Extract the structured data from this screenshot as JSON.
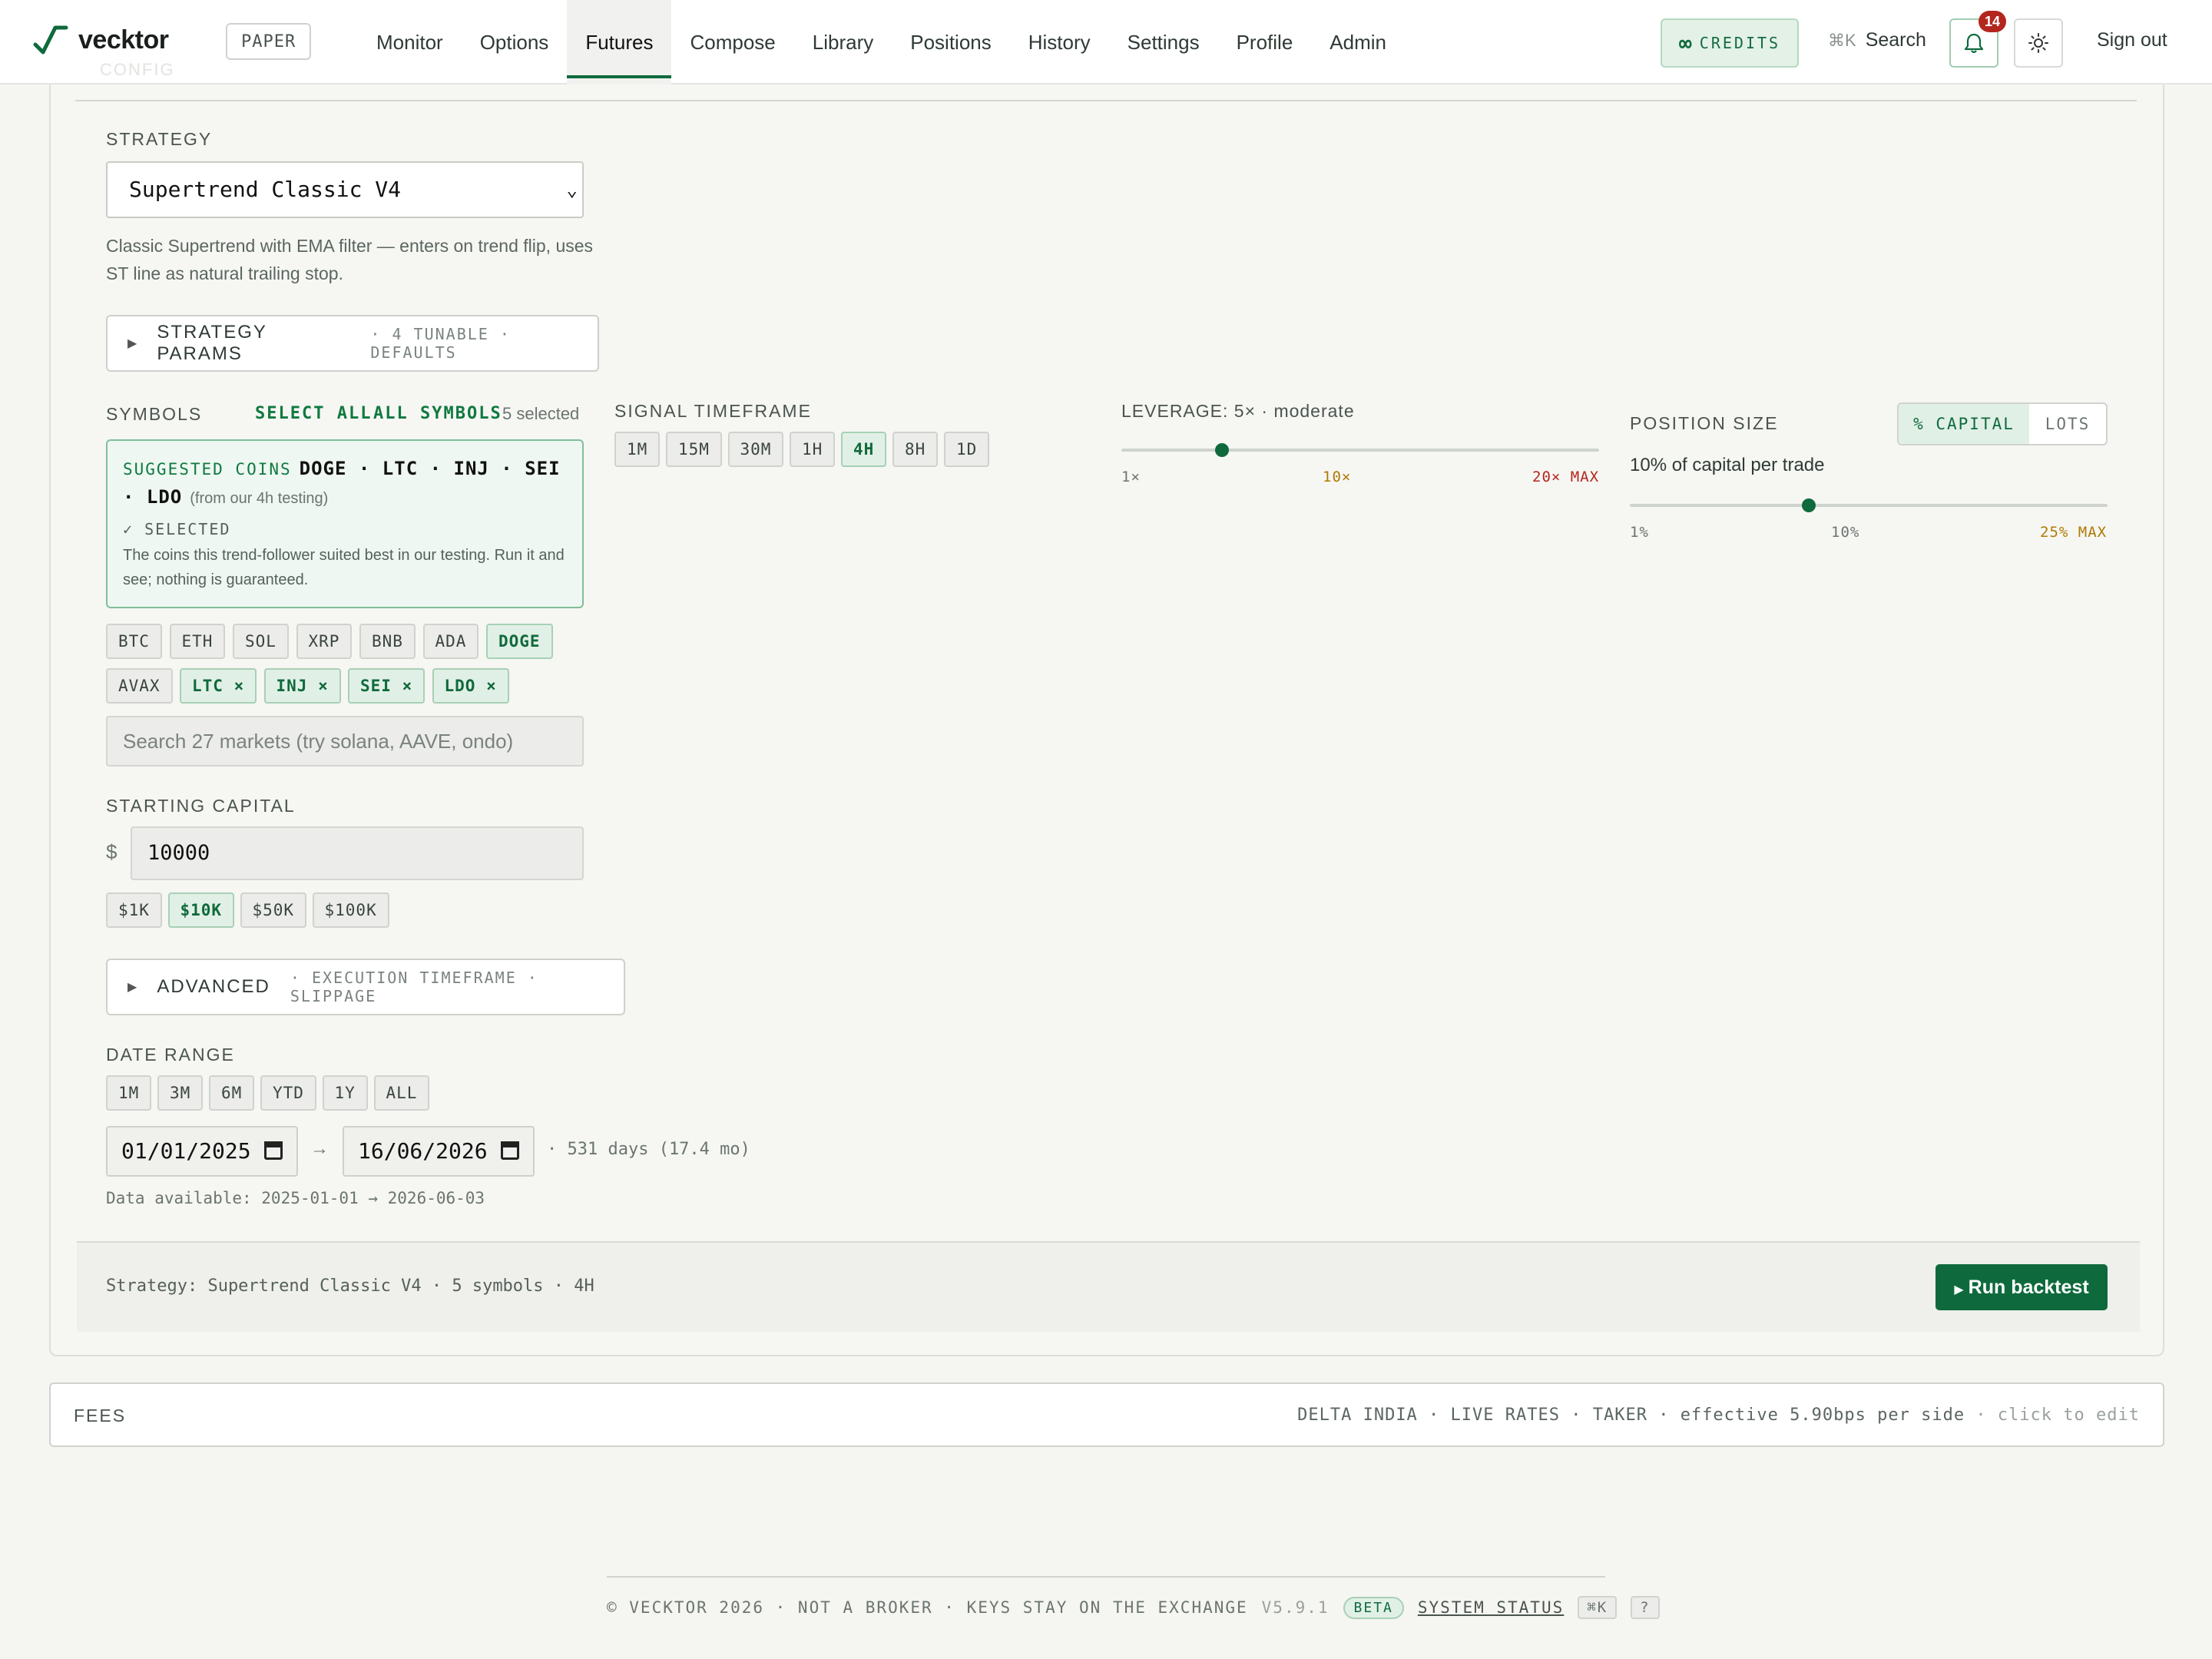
{
  "nav": {
    "brand": "vecktor",
    "mode_badge": "PAPER",
    "links": [
      "Monitor",
      "Options",
      "Futures",
      "Compose",
      "Library",
      "Positions",
      "History",
      "Settings",
      "Profile",
      "Admin"
    ],
    "active_link": "Futures",
    "credits_label": "CREDITS",
    "credits_symbol": "∞",
    "search_kbd": "⌘K",
    "search_label": "Search",
    "notification_count": "14",
    "signout_label": "Sign out",
    "ghost_section": "CONFIG"
  },
  "strategy": {
    "label": "STRATEGY",
    "selected": "Supertrend Classic V4",
    "description": "Classic Supertrend with EMA filter — enters on trend flip, uses ST line as natural trailing stop.",
    "params_title": "STRATEGY PARAMS",
    "params_meta": "· 4 TUNABLE · DEFAULTS"
  },
  "symbols": {
    "label": "SYMBOLS",
    "select_all": "SELECT ALL",
    "all_symbols": "ALL SYMBOLS",
    "selected_count": "5 selected",
    "suggested_label": "SUGGESTED COINS",
    "suggested_coins": "DOGE · LTC · INJ · SEI · LDO",
    "suggested_from": "(from our 4h testing)",
    "suggested_status": "✓ SELECTED",
    "suggested_note": "The coins this trend-follower suited best in our testing. Run it and see; nothing is guaranteed.",
    "chips_row1": [
      {
        "label": "BTC",
        "on": false
      },
      {
        "label": "ETH",
        "on": false
      },
      {
        "label": "SOL",
        "on": false
      },
      {
        "label": "XRP",
        "on": false
      },
      {
        "label": "BNB",
        "on": false
      },
      {
        "label": "ADA",
        "on": false
      },
      {
        "label": "DOGE",
        "on": true
      }
    ],
    "chips_row2": [
      {
        "label": "AVAX",
        "on": false
      },
      {
        "label": "LTC ×",
        "on": true
      },
      {
        "label": "INJ ×",
        "on": true
      },
      {
        "label": "SEI ×",
        "on": true
      },
      {
        "label": "LDO ×",
        "on": true
      }
    ],
    "search_placeholder": "Search 27 markets (try solana, AAVE, ondo)"
  },
  "capital": {
    "label": "STARTING CAPITAL",
    "currency": "$",
    "value": "10000",
    "presets": [
      {
        "label": "$1K",
        "on": false
      },
      {
        "label": "$10K",
        "on": true
      },
      {
        "label": "$50K",
        "on": false
      },
      {
        "label": "$100K",
        "on": false
      }
    ]
  },
  "advanced": {
    "title": "ADVANCED",
    "meta": "· EXECUTION TIMEFRAME · SLIPPAGE"
  },
  "date_range": {
    "label": "DATE RANGE",
    "presets": [
      "1M",
      "3M",
      "6M",
      "YTD",
      "1Y",
      "ALL"
    ],
    "start": "01/01/2025",
    "end": "16/06/2026",
    "arrow": "→",
    "span": "· 531 days (17.4 mo)",
    "available": "Data available: 2025-01-01 → 2026-06-03"
  },
  "timeframe": {
    "label": "SIGNAL TIMEFRAME",
    "options": [
      "1M",
      "15M",
      "30M",
      "1H",
      "4H",
      "8H",
      "1D"
    ],
    "selected": "4H"
  },
  "leverage": {
    "label": "LEVERAGE: 5× · moderate",
    "value": 5,
    "min": 1,
    "max": 20,
    "tick_min": "1×",
    "tick_mid": "10×",
    "tick_max": "20× MAX"
  },
  "position_size": {
    "label": "POSITION SIZE",
    "mode_capital": "% CAPITAL",
    "mode_lots": "LOTS",
    "summary": "10% of capital per trade",
    "value": 10,
    "min": 1,
    "max": 25,
    "tick_min": "1%",
    "tick_mid": "10%",
    "tick_max": "25% MAX"
  },
  "summary_bar": {
    "text": "Strategy: Supertrend Classic V4 · 5 symbols · 4H",
    "run_label": "Run backtest"
  },
  "fees": {
    "label": "FEES",
    "info": "DELTA INDIA · LIVE RATES · TAKER · effective 5.90bps per side",
    "hint": "· click to edit"
  },
  "footer": {
    "text": "© VECKTOR 2026 · NOT A BROKER · KEYS STAY ON THE EXCHANGE",
    "version": "V5.9.1",
    "beta": "BETA",
    "status": "SYSTEM STATUS",
    "kbd": "⌘K",
    "help": "?"
  },
  "colors": {
    "accent": "#0e6a3c",
    "accent_soft": "#e1f0e6",
    "warn": "#b07a00",
    "danger": "#b3261e"
  }
}
